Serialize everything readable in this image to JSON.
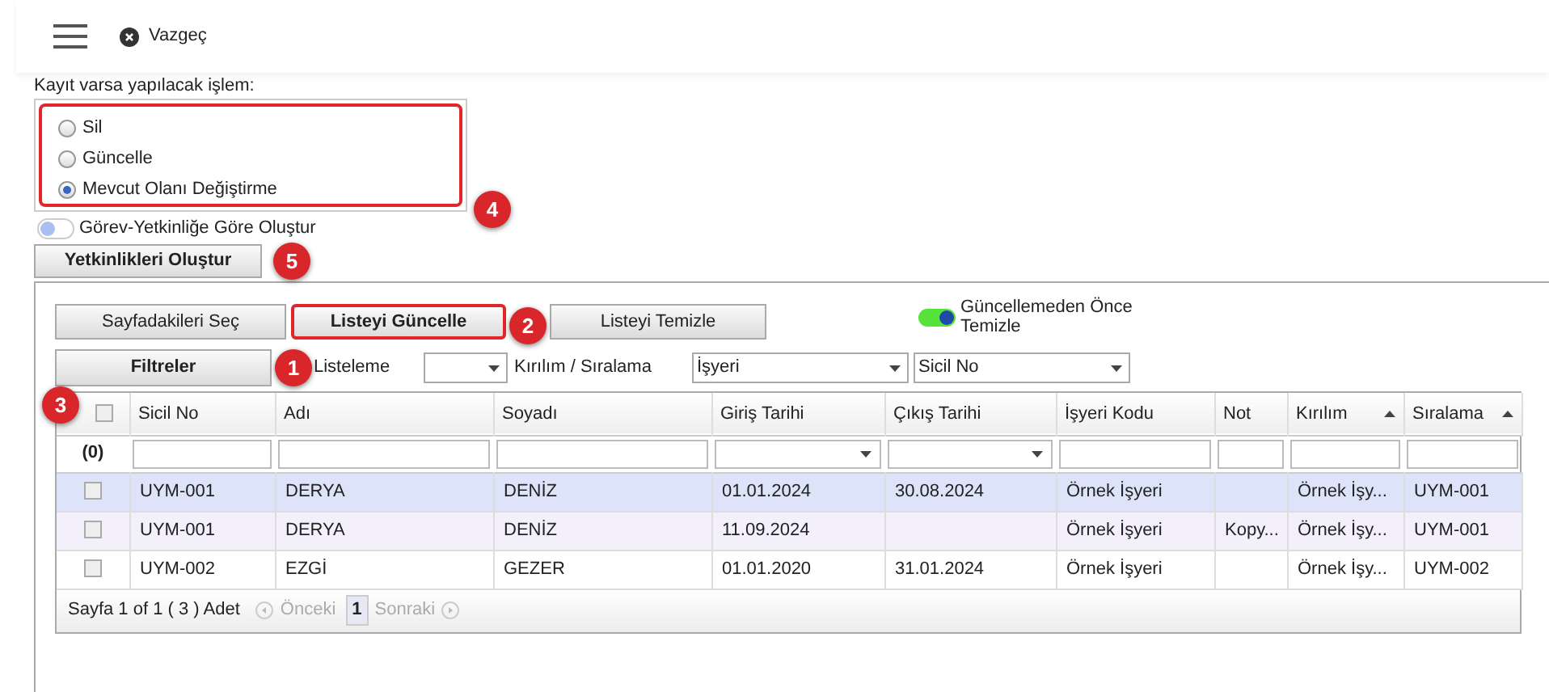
{
  "toolbar": {
    "cancel_label": "Vazgeç"
  },
  "record_action": {
    "label": "Kayıt varsa yapılacak işlem:",
    "outlined": true,
    "annotation": "4",
    "options": [
      {
        "label": "Sil",
        "selected": false
      },
      {
        "label": "Güncelle",
        "selected": false
      },
      {
        "label": "Mevcut Olanı Değiştirme",
        "selected": true
      }
    ]
  },
  "role_toggle": {
    "label": "Görev-Yetkinliğe Göre Oluştur",
    "on": false
  },
  "create_button": {
    "label": "Yetkinlikleri Oluştur",
    "annotation": "5"
  },
  "action_buttons": [
    {
      "label": "Sayfadakileri Seç",
      "bold": false,
      "outlined": false
    },
    {
      "label": "Listeyi Güncelle",
      "bold": true,
      "outlined": true,
      "annotation": "2"
    },
    {
      "label": "Listeyi Temizle",
      "bold": false,
      "outlined": false
    }
  ],
  "clear_toggle": {
    "label": "Güncellemeden Önce Temizle",
    "on": true
  },
  "filters_button": {
    "label": "Filtreler",
    "annotation": "1"
  },
  "listing": {
    "label": "Listeleme"
  },
  "sorting": {
    "label": "Kırılım / Sıralama",
    "break_value": "İşyeri",
    "order_value": "Sicil No"
  },
  "table": {
    "annotation": "3",
    "all_checked": false,
    "filter_count": "(0)",
    "columns": [
      {
        "label": "Sicil No",
        "kind": "text",
        "sorted": false
      },
      {
        "label": "Adı",
        "kind": "text",
        "sorted": false
      },
      {
        "label": "Soyadı",
        "kind": "text",
        "sorted": false
      },
      {
        "label": "Giriş Tarihi",
        "kind": "dropdown",
        "sorted": false
      },
      {
        "label": "Çıkış Tarihi",
        "kind": "dropdown",
        "sorted": false
      },
      {
        "label": "İşyeri Kodu",
        "kind": "text",
        "sorted": false
      },
      {
        "label": "Not",
        "kind": "text",
        "sorted": false
      },
      {
        "label": "Kırılım",
        "kind": "text",
        "sorted": true
      },
      {
        "label": "Sıralama",
        "kind": "text",
        "sorted": true
      }
    ],
    "rows": [
      {
        "selected": true,
        "hovered": false,
        "checked": false,
        "cells": [
          "UYM-001",
          "DERYA",
          "DENİZ",
          "01.01.2024",
          "30.08.2024",
          "Örnek İşyeri",
          null,
          "Örnek İşy...",
          "UYM-001"
        ]
      },
      {
        "selected": false,
        "hovered": true,
        "checked": false,
        "cells": [
          "UYM-001",
          "DERYA",
          "DENİZ",
          "11.09.2024",
          null,
          "Örnek İşyeri",
          "Kopy...",
          "Örnek İşy...",
          "UYM-001"
        ]
      },
      {
        "selected": false,
        "hovered": false,
        "checked": false,
        "cells": [
          "UYM-002",
          "EZGİ",
          "GEZER",
          "01.01.2020",
          "31.01.2024",
          "Örnek İşyeri",
          null,
          "Örnek İşy...",
          "UYM-002"
        ]
      }
    ]
  },
  "pager": {
    "summary": "Sayfa 1 of 1 ( 3 ) Adet",
    "prev": "Önceki",
    "page": "1",
    "next": "Sonraki"
  }
}
